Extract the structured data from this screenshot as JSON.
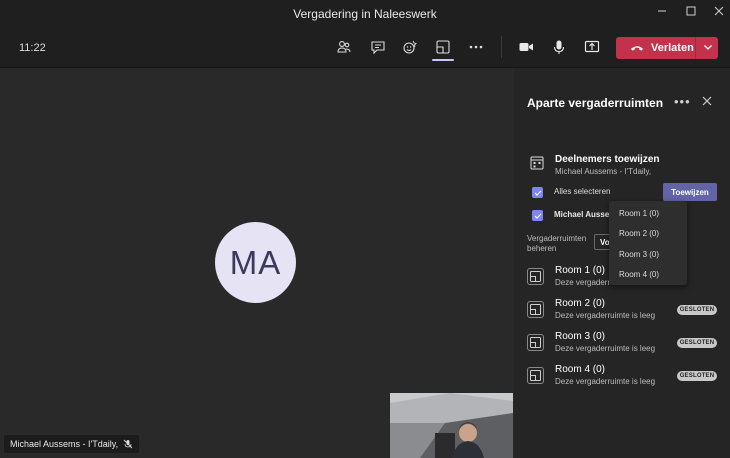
{
  "window": {
    "title": "Vergadering in Naleeswerk"
  },
  "toolbar": {
    "time": "11:22",
    "leave_label": "Verlaten",
    "icons": [
      "people-icon",
      "chat-icon",
      "reactions-icon",
      "breakout-rooms-icon",
      "more-icon",
      "camera-icon",
      "mic-icon",
      "share-icon"
    ]
  },
  "stage": {
    "avatar_initials": "MA",
    "name_chip": "Michael Aussems - I'Tdaily,"
  },
  "panel": {
    "title": "Aparte vergaderruimten",
    "assign_title": "Deelnemers toewijzen",
    "assign_subtitle": "Michael Aussems - I'Tdaily,",
    "select_all": "Alles selecteren",
    "assign_button": "Toewijzen",
    "participant": "Michael Aussem",
    "manage_label": "Vergaderruimten beheren",
    "manage_button": "Vo",
    "rooms": [
      {
        "name": "Room 1 (0)",
        "desc": "Deze vergaderr",
        "badge": ""
      },
      {
        "name": "Room 2 (0)",
        "desc": "Deze vergaderruimte is leeg",
        "badge": "GESLOTEN"
      },
      {
        "name": "Room 3 (0)",
        "desc": "Deze vergaderruimte is leeg",
        "badge": "GESLOTEN"
      },
      {
        "name": "Room 4 (0)",
        "desc": "Deze vergaderruimte is leeg",
        "badge": "GESLOTEN"
      }
    ]
  },
  "dropdown": {
    "items": [
      "Room 1 (0)",
      "Room 2 (0)",
      "Room 3 (0)",
      "Room 4 (0)"
    ]
  },
  "colors": {
    "leave": "#c4314b",
    "accent": "#6264a7",
    "checkbox": "#7f85f5"
  }
}
